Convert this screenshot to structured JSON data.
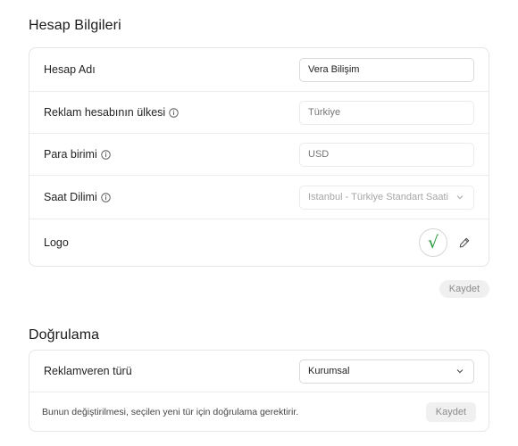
{
  "account": {
    "title": "Hesap Bilgileri",
    "name_label": "Hesap Adı",
    "name_value": "Vera Bilişim",
    "country_label": "Reklam hesabının ülkesi",
    "country_placeholder": "Türkiye",
    "currency_label": "Para birimi",
    "currency_placeholder": "USD",
    "timezone_label": "Saat Dilimi",
    "timezone_value": "Istanbul - Türkiye Standart Saati",
    "logo_label": "Logo",
    "logo_mark": "√",
    "save_label": "Kaydet"
  },
  "verification": {
    "title": "Doğrulama",
    "advertiser_type_label": "Reklamveren türü",
    "advertiser_type_value": "Kurumsal",
    "note": "Bunun değiştirilmesi, seçilen yeni tür için doğrulama gerektirir.",
    "save_label": "Kaydet"
  },
  "colors": {
    "check": "#2a9a3c",
    "button_bg": "#f0f0f0",
    "button_text": "#8c8c8c",
    "border": "#e6e6e6"
  }
}
